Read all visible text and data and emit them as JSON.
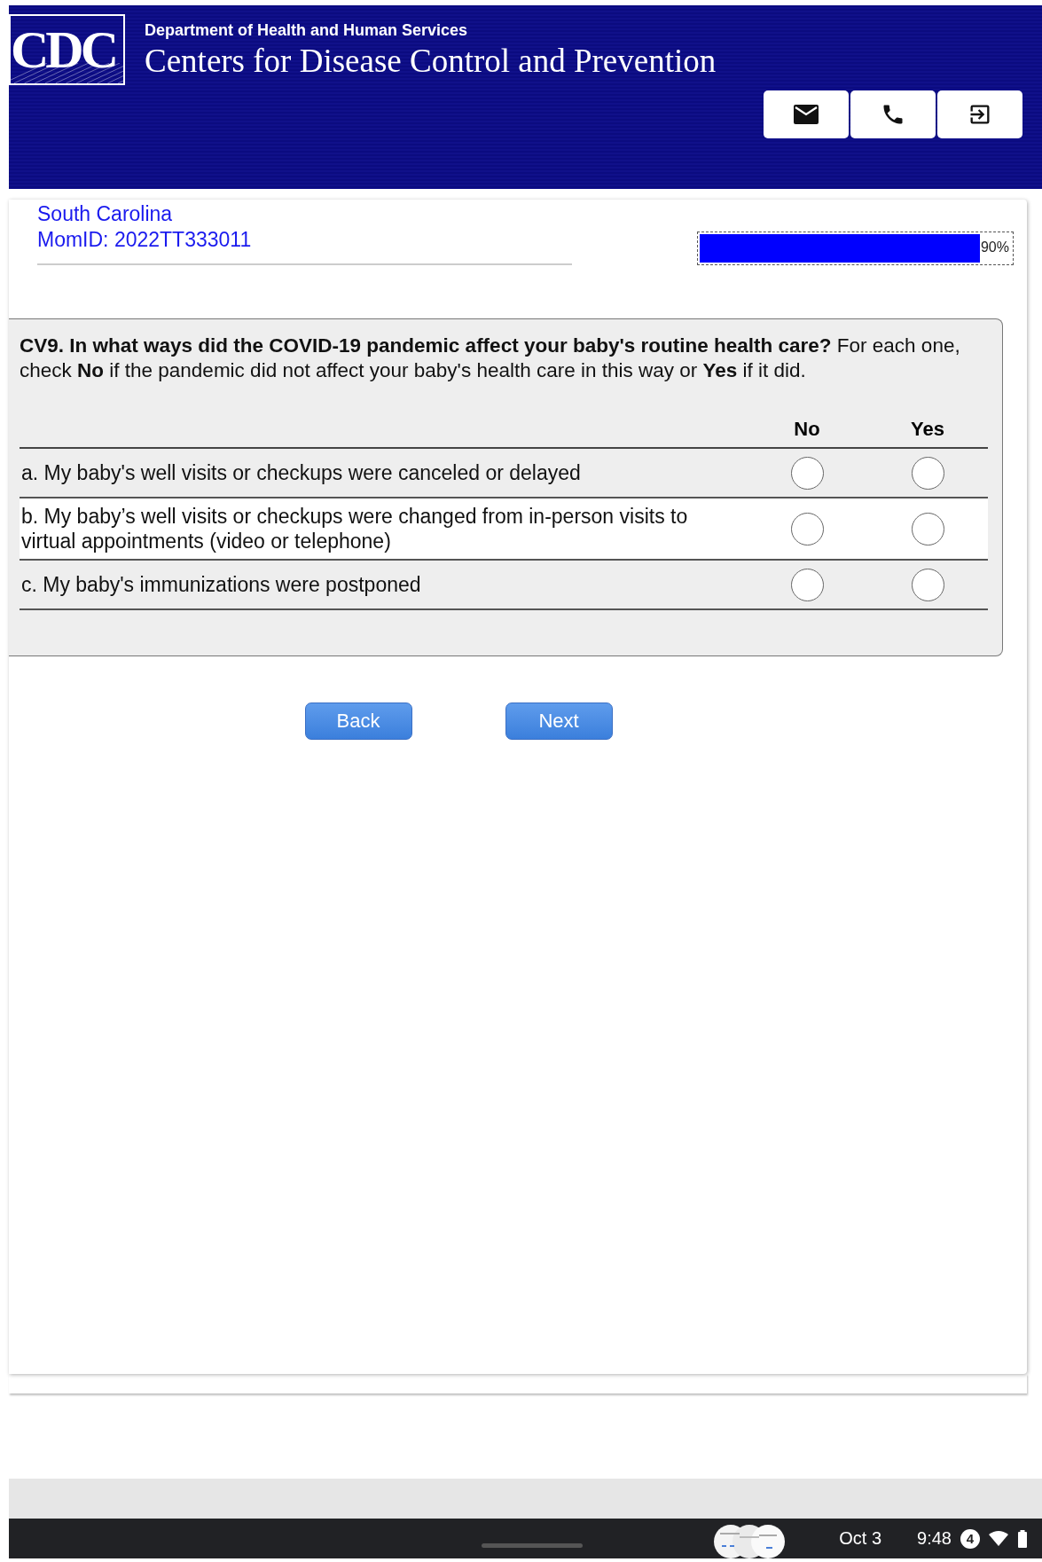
{
  "header": {
    "logo": "CDC",
    "department": "Department of Health and Human Services",
    "title": "Centers for Disease Control and Prevention",
    "actions": [
      {
        "kind": "mail"
      },
      {
        "kind": "phone"
      },
      {
        "kind": "exit"
      }
    ]
  },
  "respondent": {
    "state": "South Carolina",
    "mom_id": "MomID: 2022TT333011"
  },
  "progress": {
    "level": 0.9,
    "reading": "90%"
  },
  "question": {
    "text": "**CV9. In what ways did the COVID-19 pandemic affect your baby's routine health care?** For each one, check **No** if the pandemic did not affect your baby's health care in this way or **Yes** if it did.",
    "columns": [
      "No",
      "Yes"
    ],
    "items": [
      {
        "label": "a. My baby's well visits or checkups were canceled or delayed",
        "highlighted": false,
        "options": [
          {
            "selected": false
          },
          {
            "selected": false
          }
        ]
      },
      {
        "label": "b. My baby’s well visits or checkups were changed from in-person visits to virtual appointments (video or telephone)",
        "highlighted": true,
        "options": [
          {
            "selected": false
          },
          {
            "selected": false
          }
        ]
      },
      {
        "label": "c. My baby's immunizations were postponed",
        "highlighted": false,
        "options": [
          {
            "selected": false
          },
          {
            "selected": false
          }
        ]
      }
    ]
  },
  "buttons": [
    "Back",
    "Next"
  ],
  "status_bar": {
    "date": "Oct 3",
    "time": "9:48",
    "notification_count": "4"
  }
}
